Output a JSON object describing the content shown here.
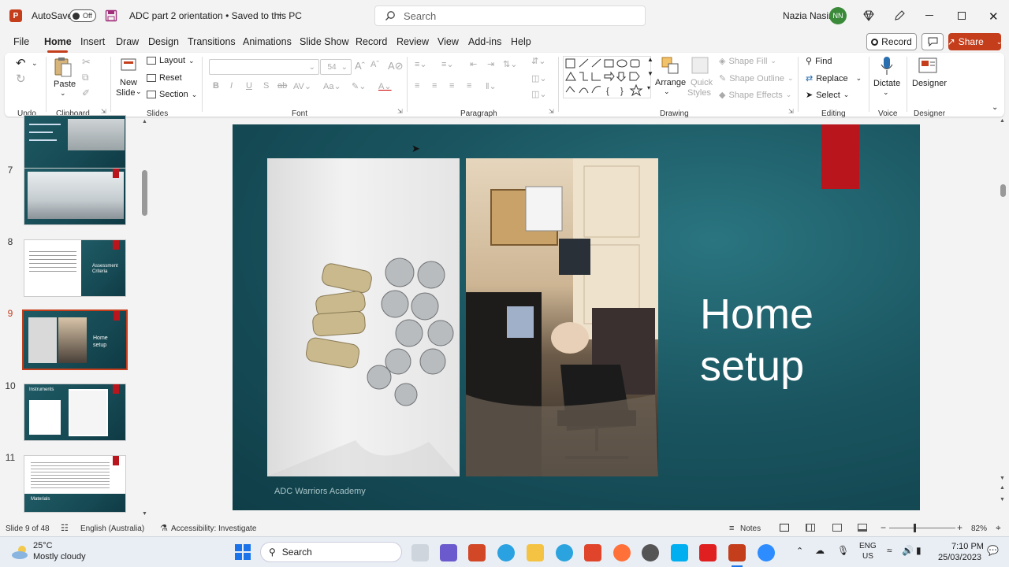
{
  "titlebar": {
    "autosave_label": "AutoSave",
    "autosave_state": "Off",
    "doc_title": "ADC part 2 orientation • Saved to this PC",
    "search_placeholder": "Search",
    "user_name": "Nazia Nasir",
    "user_initials": "NN"
  },
  "menu": {
    "items": [
      "File",
      "Home",
      "Insert",
      "Draw",
      "Design",
      "Transitions",
      "Animations",
      "Slide Show",
      "Record",
      "Review",
      "View",
      "Add-ins",
      "Help"
    ],
    "active": "Home",
    "record_label": "Record",
    "share_label": "Share"
  },
  "ribbon": {
    "groups": {
      "undo": "Undo",
      "clipboard": "Clipboard",
      "slides": "Slides",
      "font": "Font",
      "paragraph": "Paragraph",
      "drawing": "Drawing",
      "editing": "Editing",
      "voice": "Voice",
      "designer": "Designer"
    },
    "paste": "Paste",
    "new_slide_1": "New",
    "new_slide_2": "Slide",
    "layout": "Layout",
    "reset": "Reset",
    "section": "Section",
    "font_size": "54",
    "arrange": "Arrange",
    "quick_styles_1": "Quick",
    "quick_styles_2": "Styles",
    "shape_fill": "Shape Fill",
    "shape_outline": "Shape Outline",
    "shape_effects": "Shape Effects",
    "find": "Find",
    "replace": "Replace",
    "select": "Select",
    "dictate": "Dictate",
    "designer_btn": "Designer"
  },
  "thumbnails": [
    {
      "num": "",
      "caption": "",
      "type": "lab"
    },
    {
      "num": "7",
      "caption": "",
      "type": "lab"
    },
    {
      "num": "8",
      "caption": "Assessment Criteria",
      "type": "doc"
    },
    {
      "num": "9",
      "caption": "Home setup",
      "type": "selected"
    },
    {
      "num": "10",
      "caption": "Instruments",
      "type": "instruments"
    },
    {
      "num": "11",
      "caption": "Materials",
      "type": "materials"
    }
  ],
  "slide": {
    "title_line1": "Home",
    "title_line2": "setup",
    "footer": "ADC Warriors Academy",
    "accent_color": "#b8161c"
  },
  "status": {
    "slide_info": "Slide 9 of 48",
    "language": "English (Australia)",
    "accessibility": "Accessibility: Investigate",
    "notes": "Notes",
    "zoom": "82%"
  },
  "taskbar": {
    "weather_temp": "25°C",
    "weather_desc": "Mostly cloudy",
    "search": "Search",
    "lang1": "ENG",
    "lang2": "US",
    "time": "7:10 PM",
    "date": "25/03/2023"
  }
}
